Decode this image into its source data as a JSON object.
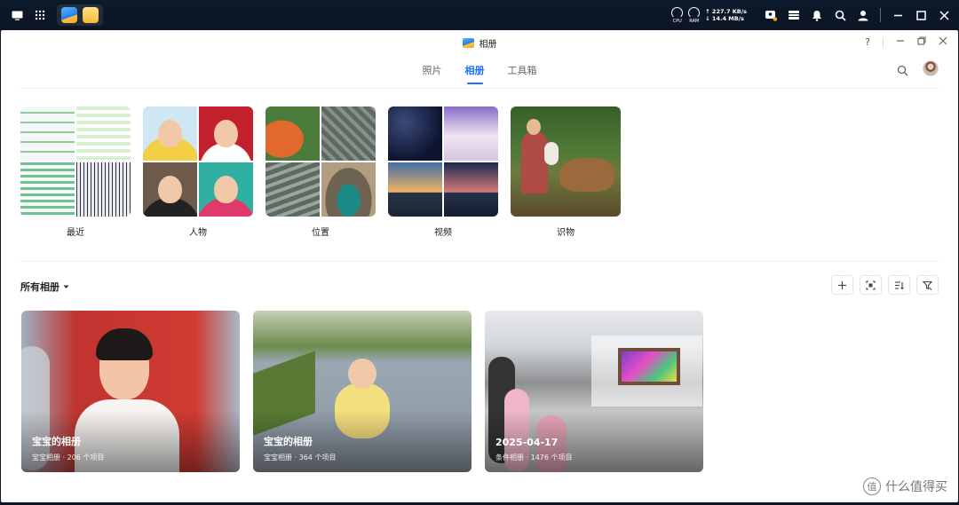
{
  "taskbar": {
    "cpu_label": "CPU",
    "ram_label": "RAM",
    "upload": "↑ 227.7 KB/s",
    "download": "↓ 14.4 MB/s"
  },
  "window": {
    "title": "相册",
    "help": "?"
  },
  "tabs": [
    {
      "label": "照片",
      "active": false
    },
    {
      "label": "相册",
      "active": true
    },
    {
      "label": "工具箱",
      "active": false
    }
  ],
  "categories": [
    {
      "label": "最近"
    },
    {
      "label": "人物"
    },
    {
      "label": "位置"
    },
    {
      "label": "视频"
    },
    {
      "label": "识物"
    }
  ],
  "albums_section": {
    "title": "所有相册"
  },
  "albums": [
    {
      "name": "宝宝的相册",
      "meta": "宝宝相册 · 206 个项目"
    },
    {
      "name": "宝宝的相册",
      "meta": "宝宝相册 · 364 个项目"
    },
    {
      "name": "2025-04-17",
      "meta": "条件相册 · 1476 个项目"
    }
  ],
  "watermark": {
    "badge": "值",
    "text": "什么值得买"
  },
  "colors": {
    "accent": "#1f6fff",
    "taskbar_bg": "#0c1626"
  }
}
